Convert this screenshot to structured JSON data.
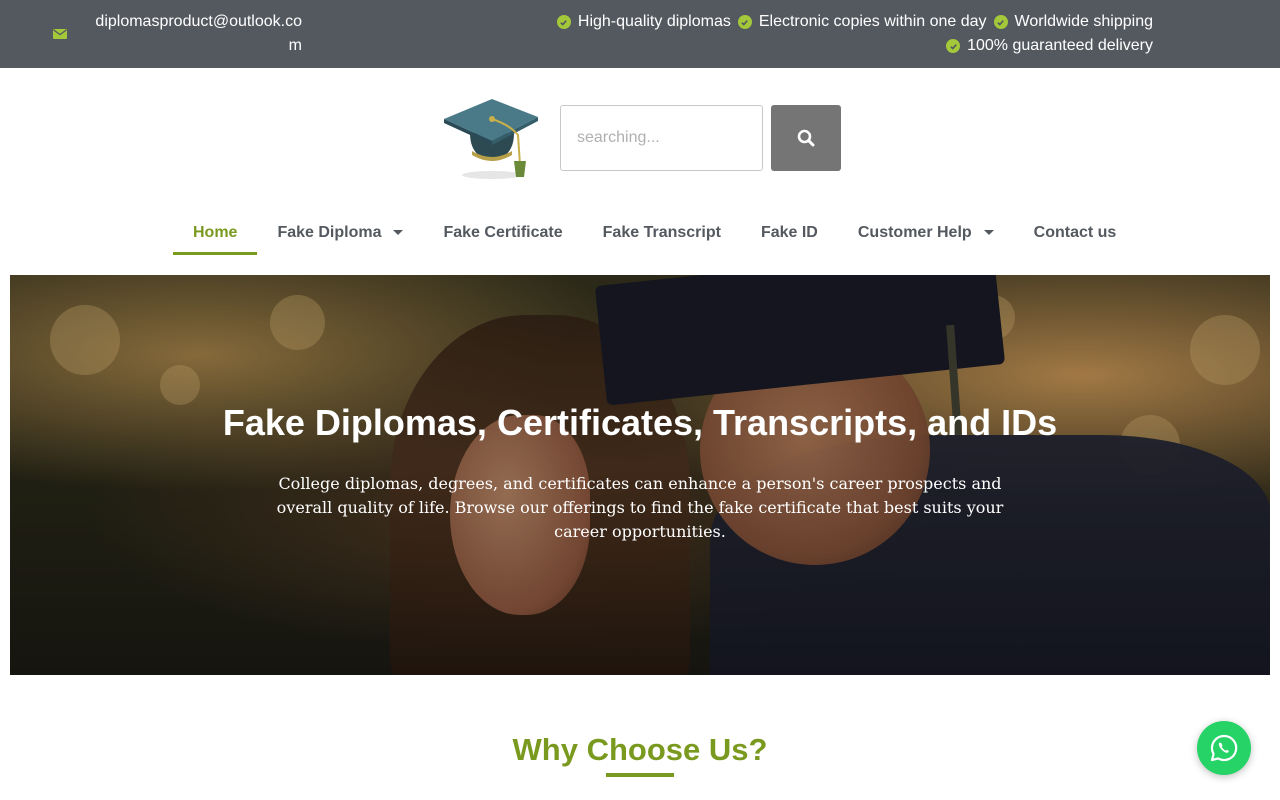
{
  "topbar": {
    "email": "diplomasproduct@outlook.com",
    "features": [
      "High-quality diplomas",
      "Electronic copies within one day",
      "Worldwide shipping",
      "100% guaranteed delivery"
    ]
  },
  "search": {
    "placeholder": "searching..."
  },
  "nav": {
    "items": [
      {
        "label": "Home"
      },
      {
        "label": "Fake Diploma"
      },
      {
        "label": "Fake Certificate"
      },
      {
        "label": "Fake Transcript"
      },
      {
        "label": "Fake ID"
      },
      {
        "label": "Customer Help"
      },
      {
        "label": "Contact us"
      }
    ]
  },
  "hero": {
    "title": "Fake Diplomas, Certificates, Transcripts, and IDs",
    "text": "College diplomas, degrees, and certificates can enhance a person's career prospects and overall quality of life. Browse our offerings to find the fake certificate that best suits your career opportunities."
  },
  "why": {
    "title": "Why Choose Us?"
  },
  "colors": {
    "topbar_bg": "#54595f",
    "accent": "#7a9a1f",
    "check": "#a3c93a",
    "search_button": "#757575",
    "whatsapp": "#25d366"
  },
  "icons": [
    "mail-icon",
    "check-circle-icon",
    "graduation-cap-logo",
    "search-icon",
    "caret-down-icon",
    "whatsapp-icon"
  ]
}
